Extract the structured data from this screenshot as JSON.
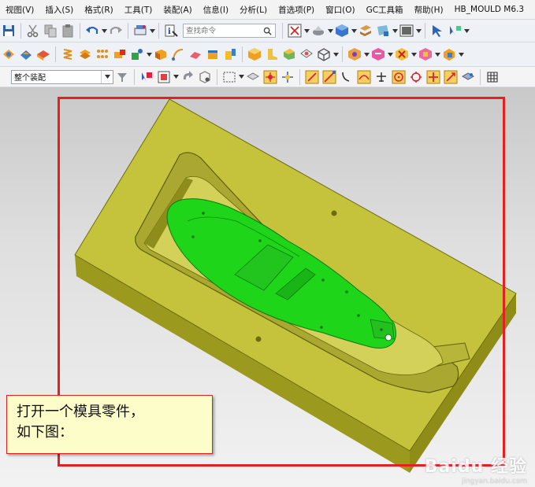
{
  "menu": [
    "视图(V)",
    "插入(S)",
    "格式(R)",
    "工具(T)",
    "装配(A)",
    "信息(I)",
    "分析(L)",
    "首选项(P)",
    "窗口(O)",
    "GC工具箱",
    "帮助(H)",
    "HB_MOULD M6.3"
  ],
  "toolbar": {
    "search_placeholder": "查找命令",
    "assembly_select": "整个装配"
  },
  "callout": {
    "line1": "打开一个模具零件，",
    "line2": "如下图："
  },
  "watermark": {
    "logo": "Baidu 经验",
    "url": "jingyan.baidu.com"
  },
  "colors": {
    "mold_base": "#c5c33c",
    "part": "#1ed51a",
    "highlight": "#e52020",
    "callout_bg": "#fdfdc9"
  }
}
